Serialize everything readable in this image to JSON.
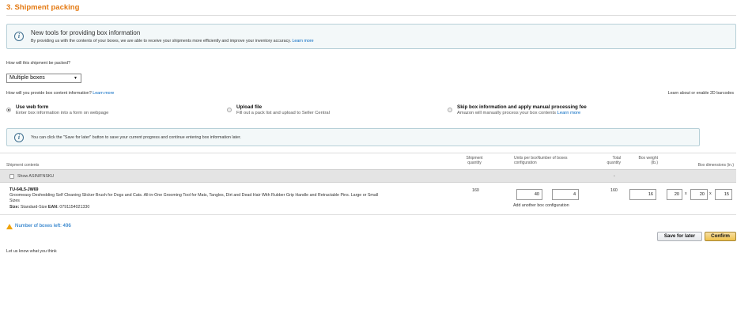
{
  "section": {
    "title": "3. Shipment packing"
  },
  "info_banner": {
    "title": "New tools for providing box information",
    "body": "By providing us with the contents of your boxes, we are able to receive your shipments more efficiently and improve your inventory accuracy.",
    "link": "Learn more"
  },
  "packing": {
    "question": "How will this shipment be packed?",
    "selected": "Multiple boxes",
    "arrow": "▼"
  },
  "box_content": {
    "question": "How will you provide box content information?",
    "learn_more": "Learn more",
    "barcodes_link": "Learn about or enable 2D barcodes",
    "options": [
      {
        "title": "Use web form",
        "subtitle": "Enter box information into a form on webpage",
        "selected": true
      },
      {
        "title": "Upload file",
        "subtitle": "Fill out a pack list and upload to Seller Central",
        "selected": false
      },
      {
        "title": "Skip box information and apply manual processing fee",
        "subtitle": "Amazon will manually process your box contents",
        "link": "Learn more",
        "selected": false
      }
    ]
  },
  "save_banner": {
    "text": "You can click the \"Save for later\" button to save your current progress and continue entering box information later."
  },
  "table": {
    "headers": {
      "contents": "Shipment contents",
      "shipment_qty_1": "Shipment",
      "shipment_qty_2": "quantity",
      "units_per_box_1": "Units per box",
      "units_per_box_2": "configuration",
      "num_boxes": "Number of boxes",
      "total_qty_1": "Total",
      "total_qty_2": "quantity",
      "box_weight_1": "Box weight",
      "box_weight_2": "(lb.)",
      "box_dims": "Box dimensions (in.)"
    },
    "dash": "-",
    "show_asin": "Show ASIN/FNSKU",
    "row": {
      "sku": "TU-64L5-JW69",
      "title_1": "Groomeasy Deshedding Self Cleaning Slicker Brush for Dogs and Cats. All-in-One Grooming Tool for Mats, Tangles, Dirt and Dead Hair With Rubber Grip Handle and Retractable Pins. Large or Small",
      "title_2": "Sizes",
      "size_label": "Size:",
      "size_value": "Standard-Size",
      "ean_label": "EAN:",
      "ean_value": "0791154021330",
      "shipment_qty": "160",
      "units_per_box": "40",
      "num_boxes": "4",
      "add_config": "Add another box configuration",
      "total_qty": "160",
      "box_weight": "16",
      "dim_l": "20",
      "dim_w": "20",
      "dim_h": "15",
      "x": "x"
    }
  },
  "boxes_left": "Number of boxes left: 496",
  "buttons": {
    "save_later": "Save for later",
    "confirm": "Confirm"
  },
  "feedback_link": "Let us know what you think"
}
